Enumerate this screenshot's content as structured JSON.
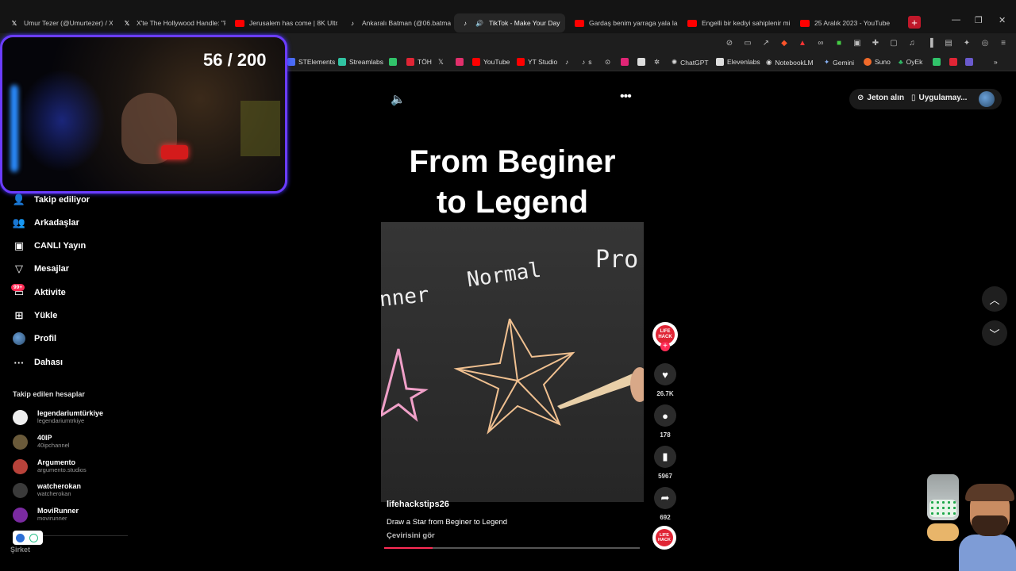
{
  "tabs": [
    {
      "label": "Umur Tezer (@Umurtezer) / X",
      "icon": "x-logo",
      "color": "#000000"
    },
    {
      "label": "X'te The Hollywood Handle: \"F",
      "icon": "x-logo",
      "color": "#000000"
    },
    {
      "label": "Jerusalem has come | 8K Ultra",
      "icon": "youtube-icon",
      "color": "#ff0000"
    },
    {
      "label": "Ankaralı Batman (@06.batman",
      "icon": "tiktok-icon",
      "color": "#000000"
    },
    {
      "label": "TikTok - Make Your Day",
      "icon": "tiktok-icon",
      "color": "#000000",
      "active": true
    },
    {
      "label": "Gardaş benim yarraga yala la n",
      "icon": "youtube-icon",
      "color": "#ff0000"
    },
    {
      "label": "Engelli bir kediyi sahiplenir mi",
      "icon": "youtube-icon",
      "color": "#ff0000"
    },
    {
      "label": "25 Aralık 2023 - YouTube",
      "icon": "youtube-icon",
      "color": "#ff0000"
    }
  ],
  "window_controls": {
    "minimize": "—",
    "restore": "❐",
    "close": "✕"
  },
  "bookmarks": [
    {
      "label": "STElements",
      "color": "#4a6cf7"
    },
    {
      "label": "Streamlabs",
      "color": "#31c3a2"
    },
    {
      "label": "",
      "color": "#31c3a2"
    },
    {
      "label": "TÖH",
      "color": "#e02535"
    },
    {
      "label": "",
      "color": "#dddddd"
    },
    {
      "label": "",
      "color": "#e1306c"
    },
    {
      "label": "YouTube",
      "color": "#ff0000"
    },
    {
      "label": "YT Studio",
      "color": "#ff0000"
    },
    {
      "label": "",
      "color": "#ffffff"
    },
    {
      "label": "s",
      "color": "#ffffff"
    },
    {
      "label": "",
      "color": "#dddddd"
    },
    {
      "label": "",
      "color": "#e02576"
    },
    {
      "label": "",
      "color": "#dddddd"
    },
    {
      "label": "",
      "color": "#dddddd"
    },
    {
      "label": "ChatGPT",
      "color": "#dddddd"
    },
    {
      "label": "Elevenlabs",
      "color": "#dddddd"
    },
    {
      "label": "NotebookLM",
      "color": "#dddddd"
    },
    {
      "label": "Gemini",
      "color": "#8ab4f8"
    },
    {
      "label": "Suno",
      "color": "#f06a2a"
    },
    {
      "label": "OyEk",
      "color": "#31c36a"
    }
  ],
  "webcam": {
    "counter": "56 / 200"
  },
  "sidebar": {
    "items": [
      {
        "label": "Takip ediliyor",
        "icon": "following-icon",
        "glyph": "👤"
      },
      {
        "label": "Arkadaşlar",
        "icon": "friends-icon",
        "glyph": "👥"
      },
      {
        "label": "CANLI Yayın",
        "icon": "live-icon",
        "glyph": "▣"
      },
      {
        "label": "Mesajlar",
        "icon": "messages-icon",
        "glyph": "▽"
      },
      {
        "label": "Aktivite",
        "icon": "activity-icon",
        "glyph": "▭"
      },
      {
        "label": "Yükle",
        "icon": "upload-icon",
        "glyph": "⊞"
      },
      {
        "label": "Profil",
        "icon": "profile-avatar-icon",
        "glyph": "●"
      },
      {
        "label": "Dahası",
        "icon": "more-icon",
        "glyph": "···"
      }
    ],
    "activity_badge": "99+",
    "following_title": "Takip edilen hesaplar",
    "following": [
      {
        "name": "legendariumtürkiye",
        "handle": "legendariumtrkiye",
        "color": "#eeeeee"
      },
      {
        "name": "40IP",
        "handle": "40ipchannel",
        "color": "#6a5a3a"
      },
      {
        "name": "Argumento",
        "handle": "argumento.studios",
        "color": "#b8423a"
      },
      {
        "name": "watcherokan",
        "handle": "watcherokan",
        "color": "#3a3a3a"
      },
      {
        "name": "MoviRunner",
        "handle": "movirunner",
        "color": "#7a2aa0"
      }
    ],
    "footer": "Şirket"
  },
  "video": {
    "headline_line1": "From Beginer",
    "headline_line2": "to Legend",
    "labels": {
      "left": "nner",
      "middle": "Normal",
      "right": "Pro"
    },
    "username": "lifehackstips26",
    "description": "Draw a Star from Beginer to Legend",
    "translate": "Çevirisini gör",
    "progress": 0.19
  },
  "actions": {
    "author_avatar_text": "LIFE HACK",
    "likes": "26.7K",
    "comments": "178",
    "saves": "5967",
    "shares": "692"
  },
  "topbar": {
    "coins": "Jeton alın",
    "app": "Uygulamay..."
  },
  "colors": {
    "accent": "#fe2c55",
    "webcam_border": "#6b3cff"
  }
}
